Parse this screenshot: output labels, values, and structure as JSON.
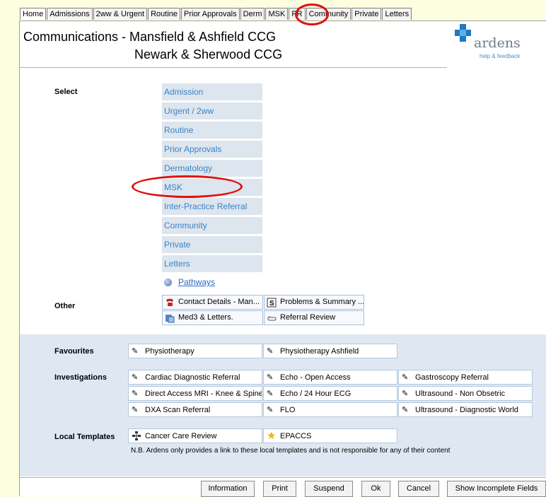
{
  "tabs": [
    "Home",
    "Admissions",
    "2ww & Urgent",
    "Routine",
    "Prior Approvals",
    "Derm",
    "MSK",
    "PR",
    "Community",
    "Private",
    "Letters"
  ],
  "active_tab": "MSK",
  "header": {
    "title_line1": "Communications - Mansfield & Ashfield CCG",
    "title_line2": "Newark & Sherwood CCG",
    "logo_text": "ardens",
    "logo_sub": "help & feedback"
  },
  "select": {
    "label": "Select",
    "items": [
      "Admission",
      "Urgent / 2ww",
      "Routine",
      "Prior Approvals",
      "Dermatology",
      "MSK",
      "Inter-Practice Referral",
      "Community",
      "Private",
      "Letters"
    ],
    "pathways": "Pathways"
  },
  "other": {
    "label": "Other",
    "buttons": [
      "Contact Details - Man...",
      "Problems & Summary ...",
      "Med3 & Letters.",
      "Referral Review"
    ]
  },
  "favourites": {
    "label": "Favourites",
    "buttons": [
      "Physiotherapy",
      "Physiotherapy Ashfield"
    ]
  },
  "investigations": {
    "label": "Investigations",
    "buttons": [
      "Cardiac Diagnostic Referral",
      "Echo - Open Access",
      "Gastroscopy Referral",
      "Direct Access MRI - Knee & Spine",
      "Echo / 24 Hour ECG",
      "Ultrasound - Non Obsetric",
      "DXA Scan Referral",
      "FLO",
      "Ultrasound - Diagnostic World"
    ]
  },
  "local_templates": {
    "label": "Local Templates",
    "buttons": [
      "Cancer Care Review",
      "EPACCS"
    ],
    "note": "N.B. Ardens only provides a link to these local templates and is not responsible for any of their content"
  },
  "footer": {
    "information": "Information",
    "print": "Print",
    "suspend": "Suspend",
    "ok": "Ok",
    "cancel": "Cancel",
    "show_incomplete": "Show Incomplete Fields"
  },
  "colors": {
    "annotation": "#e01010",
    "select_bg": "#dde5ee",
    "select_text": "#3a84c8",
    "band_bg": "#dfe8f2"
  }
}
